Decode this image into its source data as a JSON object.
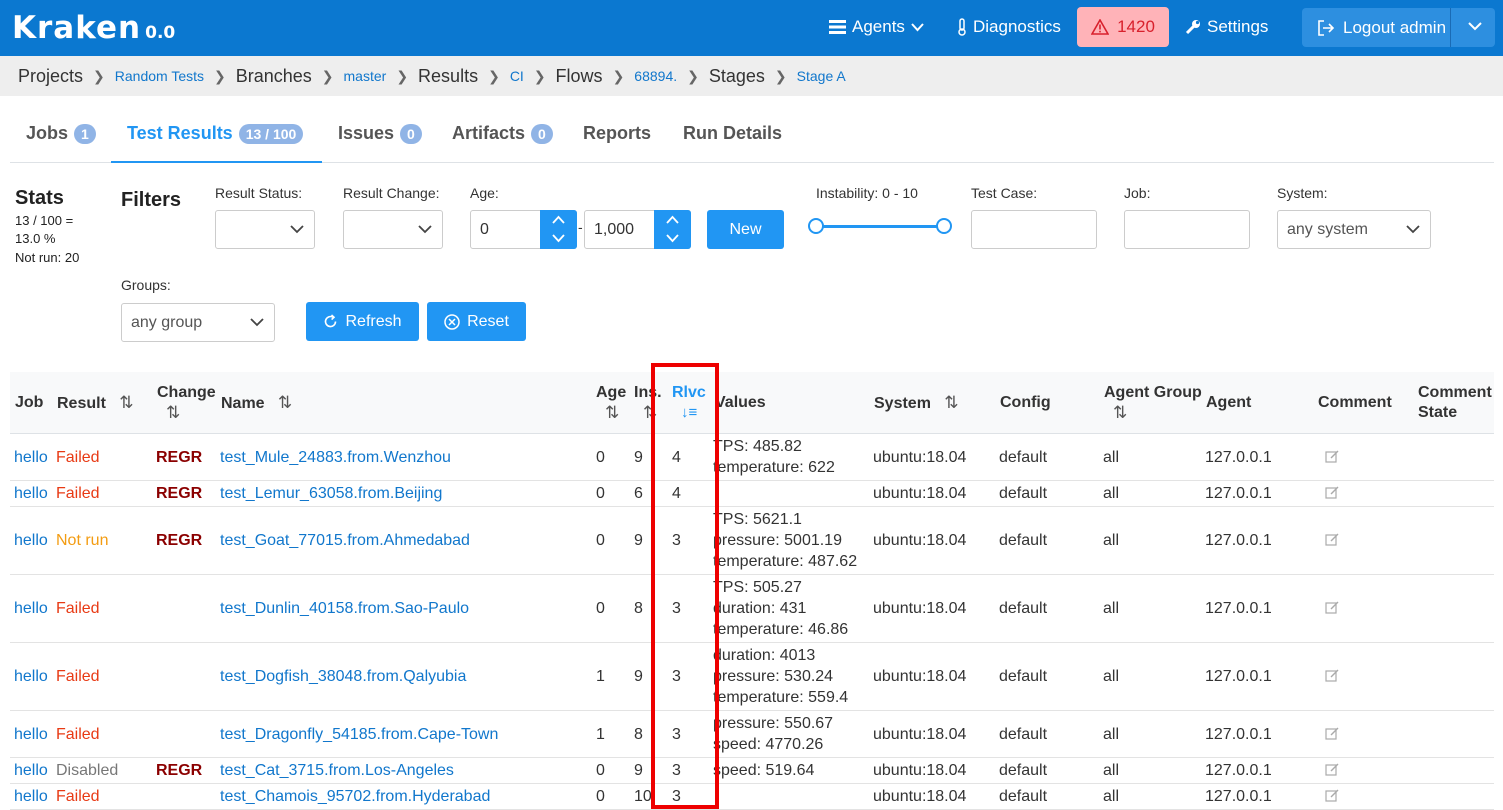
{
  "nav": {
    "logo": "Kraken",
    "version": "0.0",
    "agents": "Agents",
    "diagnostics": "Diagnostics",
    "alerts": "1420",
    "settings": "Settings",
    "logout": "Logout admin"
  },
  "breadcrumb": {
    "projects": "Projects",
    "project": "Random Tests",
    "branches": "Branches",
    "branch": "master",
    "results": "Results",
    "ci": "CI",
    "flows": "Flows",
    "flow": "68894.",
    "stages": "Stages",
    "stage": "Stage A"
  },
  "tabs": [
    {
      "label": "Jobs",
      "badge": "1"
    },
    {
      "label": "Test Results",
      "badge": "13 / 100"
    },
    {
      "label": "Issues",
      "badge": "0"
    },
    {
      "label": "Artifacts",
      "badge": "0"
    },
    {
      "label": "Reports",
      "badge": ""
    },
    {
      "label": "Run Details",
      "badge": ""
    }
  ],
  "stats": {
    "title": "Stats",
    "line1": "13 / 100 =",
    "line2": "13.0 %",
    "line3": "Not run: 20"
  },
  "filters": {
    "title": "Filters",
    "result_status_label": "Result Status:",
    "result_change_label": "Result Change:",
    "age_label": "Age:",
    "age_from": "0",
    "age_dash": "-",
    "age_to": "1,000",
    "new_button": "New",
    "instability_label": "Instability: 0 - 10",
    "instability_min": 0,
    "instability_max": 10,
    "test_case_label": "Test Case:",
    "job_label": "Job:",
    "system_label": "System:",
    "system_value": "any system",
    "groups_label": "Groups:",
    "groups_value": "any group",
    "refresh_button": "Refresh",
    "reset_button": "Reset"
  },
  "table": {
    "headers": {
      "job": "Job",
      "result": "Result",
      "change": "Change",
      "name": "Name",
      "age": "Age",
      "ins": "Ins.",
      "rlvc": "Rlvc",
      "values": "Values",
      "system": "System",
      "config": "Config",
      "agent_group": "Agent Group",
      "agent": "Agent",
      "comment": "Comment",
      "comment_state_1": "Comment",
      "comment_state_2": "State"
    },
    "rows": [
      {
        "job": "hello",
        "result": "Failed",
        "change": "REGR",
        "name": "test_Mule_24883.from.Wenzhou",
        "age": "0",
        "ins": "9",
        "rlvc": "4",
        "values": "TPS: 485.82\ntemperature: 622",
        "system": "ubuntu:18.04",
        "config": "default",
        "group": "all",
        "agent": "127.0.0.1"
      },
      {
        "job": "hello",
        "result": "Failed",
        "change": "REGR",
        "name": "test_Lemur_63058.from.Beijing",
        "age": "0",
        "ins": "6",
        "rlvc": "4",
        "values": "",
        "system": "ubuntu:18.04",
        "config": "default",
        "group": "all",
        "agent": "127.0.0.1"
      },
      {
        "job": "hello",
        "result": "Not run",
        "change": "REGR",
        "name": "test_Goat_77015.from.Ahmedabad",
        "age": "0",
        "ins": "9",
        "rlvc": "3",
        "values": "TPS: 5621.1\npressure: 5001.19\ntemperature: 487.62",
        "system": "ubuntu:18.04",
        "config": "default",
        "group": "all",
        "agent": "127.0.0.1"
      },
      {
        "job": "hello",
        "result": "Failed",
        "change": "",
        "name": "test_Dunlin_40158.from.Sao-Paulo",
        "age": "0",
        "ins": "8",
        "rlvc": "3",
        "values": "TPS: 505.27\nduration: 431\ntemperature: 46.86",
        "system": "ubuntu:18.04",
        "config": "default",
        "group": "all",
        "agent": "127.0.0.1"
      },
      {
        "job": "hello",
        "result": "Failed",
        "change": "",
        "name": "test_Dogfish_38048.from.Qalyubia",
        "age": "1",
        "ins": "9",
        "rlvc": "3",
        "values": "duration: 4013\npressure: 530.24\ntemperature: 559.4",
        "system": "ubuntu:18.04",
        "config": "default",
        "group": "all",
        "agent": "127.0.0.1"
      },
      {
        "job": "hello",
        "result": "Failed",
        "change": "",
        "name": "test_Dragonfly_54185.from.Cape-Town",
        "age": "1",
        "ins": "8",
        "rlvc": "3",
        "values": "pressure: 550.67\nspeed: 4770.26",
        "system": "ubuntu:18.04",
        "config": "default",
        "group": "all",
        "agent": "127.0.0.1"
      },
      {
        "job": "hello",
        "result": "Disabled",
        "change": "REGR",
        "name": "test_Cat_3715.from.Los-Angeles",
        "age": "0",
        "ins": "9",
        "rlvc": "3",
        "values": "speed: 519.64",
        "system": "ubuntu:18.04",
        "config": "default",
        "group": "all",
        "agent": "127.0.0.1"
      },
      {
        "job": "hello",
        "result": "Failed",
        "change": "",
        "name": "test_Chamois_95702.from.Hyderabad",
        "age": "0",
        "ins": "10",
        "rlvc": "3",
        "values": "",
        "system": "ubuntu:18.04",
        "config": "default",
        "group": "all",
        "agent": "127.0.0.1"
      }
    ]
  },
  "colors": {
    "brand": "#0b78d0",
    "accent": "#2196f3",
    "failed": "#e83a14",
    "not_run": "#f39c12",
    "regr": "#8b0000",
    "highlight": "#ee0000"
  }
}
